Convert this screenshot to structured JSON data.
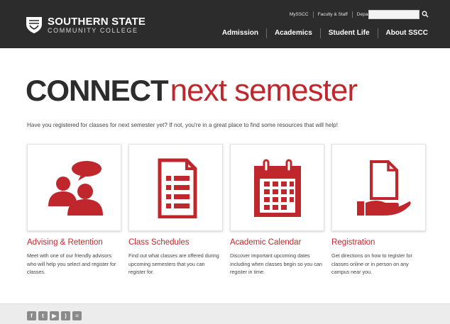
{
  "header": {
    "logo": {
      "line1": "SOUTHERN STATE",
      "line2": "COMMUNITY COLLEGE"
    },
    "utility_links": [
      "MySSCC",
      "Faculty & Staff",
      "Departments"
    ],
    "search": {
      "placeholder": ""
    },
    "main_nav": [
      "Admission",
      "Academics",
      "Student Life",
      "About SSCC"
    ]
  },
  "hero": {
    "bold": "CONNECT",
    "thin": "next semester",
    "intro": "Have you registered for classes for next semester yet? If not, you're in a great place to find some resources that will help!"
  },
  "cards": [
    {
      "title": "Advising & Retention",
      "desc": "Meet with one of our friendly advisors who will help you select and register for classes.",
      "icon": "people-chat-icon"
    },
    {
      "title": "Class Schedules",
      "desc": "Find out what classes are offered during upcoming semesters that you can register for.",
      "icon": "document-list-icon"
    },
    {
      "title": "Academic Calendar",
      "desc": "Discover important upcoming dates including when classes begin so you can register in time.",
      "icon": "calendar-icon"
    },
    {
      "title": "Registration",
      "desc": "Get directions on how to register for classes online or in person on any campus near you.",
      "icon": "hand-document-icon"
    }
  ],
  "footer": {
    "social": [
      "facebook-icon",
      "twitter-icon",
      "youtube-icon",
      "rss-icon",
      "news-icon"
    ]
  },
  "colors": {
    "brand_red": "#c0272d",
    "header_bg": "#2c2c2c"
  }
}
